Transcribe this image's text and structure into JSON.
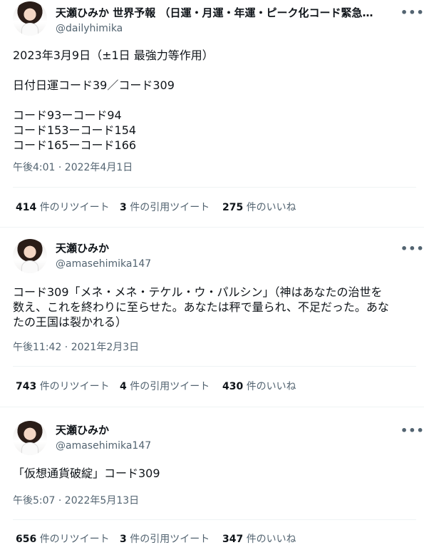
{
  "tweets": [
    {
      "name": "天瀬ひみか 世界予報 （日運・月運・年運・ピーク化コード緊急警…",
      "handle": "@dailyhimika",
      "lines": [
        "2023年3月9日（±1日 最強力等作用）",
        "",
        "日付日運コード39／コード309",
        "",
        "コード93ーコード94",
        "コード153ーコード154",
        "コード165ーコード166"
      ],
      "time": "午後4:01 · 2022年4月1日",
      "retweets": "414",
      "retweets_label": "件のリツイート",
      "quotes": "3",
      "quotes_label": "件の引用ツイート",
      "likes": "275",
      "likes_label": "件のいいね"
    },
    {
      "name": "天瀬ひみか",
      "handle": "@amasehimika147",
      "lines": [
        "コード309「メネ・メネ・テケル・ウ・パルシン」（神はあなたの治世を",
        "数え、これを終わりに至らせた。あなたは秤で量られ、不足だった。あな",
        "たの王国は裂かれる）"
      ],
      "time": "午後11:42 · 2021年2月3日",
      "retweets": "743",
      "retweets_label": "件のリツイート",
      "quotes": "4",
      "quotes_label": "件の引用ツイート",
      "likes": "430",
      "likes_label": "件のいいね"
    },
    {
      "name": "天瀬ひみか",
      "handle": "@amasehimika147",
      "lines": [
        "「仮想通貨破綻」コード309"
      ],
      "time": "午後5:07 · 2022年5月13日",
      "retweets": "656",
      "retweets_label": "件のリツイート",
      "quotes": "3",
      "quotes_label": "件の引用ツイート",
      "likes": "347",
      "likes_label": "件のいいね"
    }
  ],
  "more_icon": "•••"
}
